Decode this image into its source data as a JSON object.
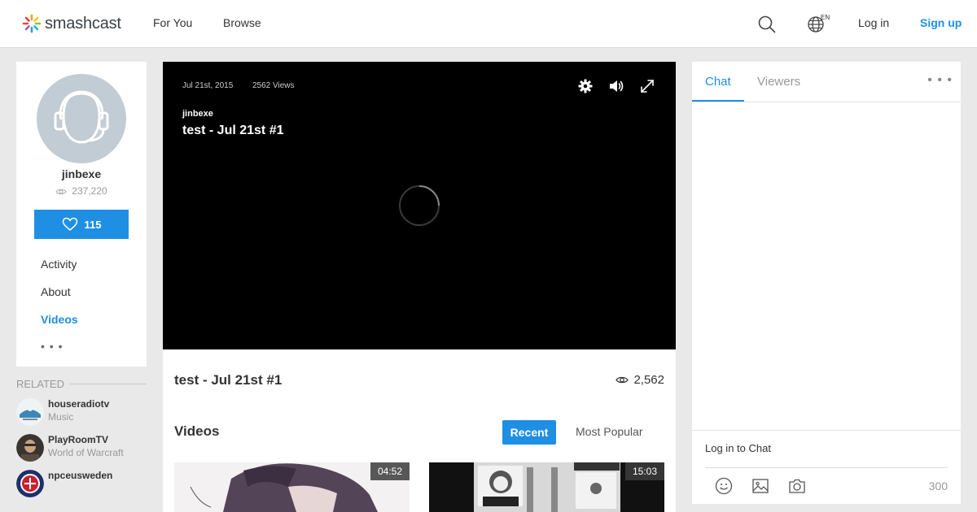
{
  "nav": {
    "logo": "smashcast",
    "for_you": "For You",
    "browse": "Browse",
    "language": "EN",
    "login": "Log in",
    "signup": "Sign up"
  },
  "profile": {
    "name": "jinbexe",
    "views": "237,220",
    "follow_count": "115",
    "menu": [
      "Activity",
      "About",
      "Videos"
    ],
    "active_menu": "Videos",
    "more": "• • •"
  },
  "related": {
    "heading": "RELATED",
    "items": [
      {
        "name": "houseradiotv",
        "game": "Music"
      },
      {
        "name": "PlayRoomTV",
        "game": "World of Warcraft"
      },
      {
        "name": "npceusweden",
        "game": ""
      }
    ]
  },
  "player": {
    "date": "Jul 21st, 2015",
    "views": "2562 Views",
    "channel": "jinbexe",
    "title": "test - Jul 21st #1"
  },
  "video_info": {
    "title": "test - Jul 21st #1",
    "views": "2,562"
  },
  "videos": {
    "heading": "Videos",
    "tab_recent": "Recent",
    "tab_popular": "Most Popular",
    "items": [
      {
        "duration": "04:52"
      },
      {
        "duration": "15:03"
      }
    ]
  },
  "chat": {
    "tab_chat": "Chat",
    "tab_viewers": "Viewers",
    "more": "• • •",
    "login_prompt": "Log in to Chat",
    "char_limit": "300"
  },
  "colors": {
    "accent": "#1f8fe4",
    "background": "#e9e9e9"
  }
}
